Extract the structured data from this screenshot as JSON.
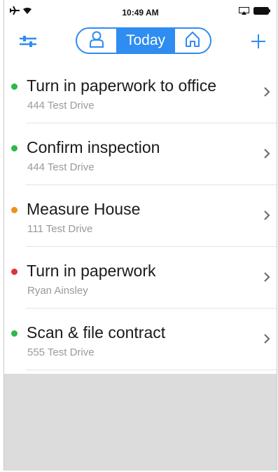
{
  "statusbar": {
    "time": "10:49 AM",
    "icons": [
      "airplane-icon",
      "wifi-icon",
      "screen-mirror-icon",
      "battery-icon"
    ]
  },
  "navbar": {
    "segments": [
      {
        "icon": "person-icon"
      },
      {
        "label": "Today",
        "selected": true
      },
      {
        "icon": "home-icon"
      }
    ],
    "left_icon": "filter-sliders-icon",
    "right_icon": "plus-icon"
  },
  "colors": {
    "accent": "#2f8cf0",
    "green": "#2db84a",
    "orange": "#f0901c",
    "red": "#e0323a",
    "empty_area": "#dcdcdc"
  },
  "tasks": [
    {
      "title": "Turn in paperwork to office",
      "subtitle": "444 Test Drive",
      "status": "green"
    },
    {
      "title": "Confirm inspection",
      "subtitle": "444 Test Drive",
      "status": "green"
    },
    {
      "title": "Measure House",
      "subtitle": "111 Test Drive",
      "status": "orange"
    },
    {
      "title": "Turn in paperwork",
      "subtitle": "Ryan Ainsley",
      "status": "red"
    },
    {
      "title": "Scan & file contract",
      "subtitle": "555 Test Drive",
      "status": "green"
    }
  ]
}
